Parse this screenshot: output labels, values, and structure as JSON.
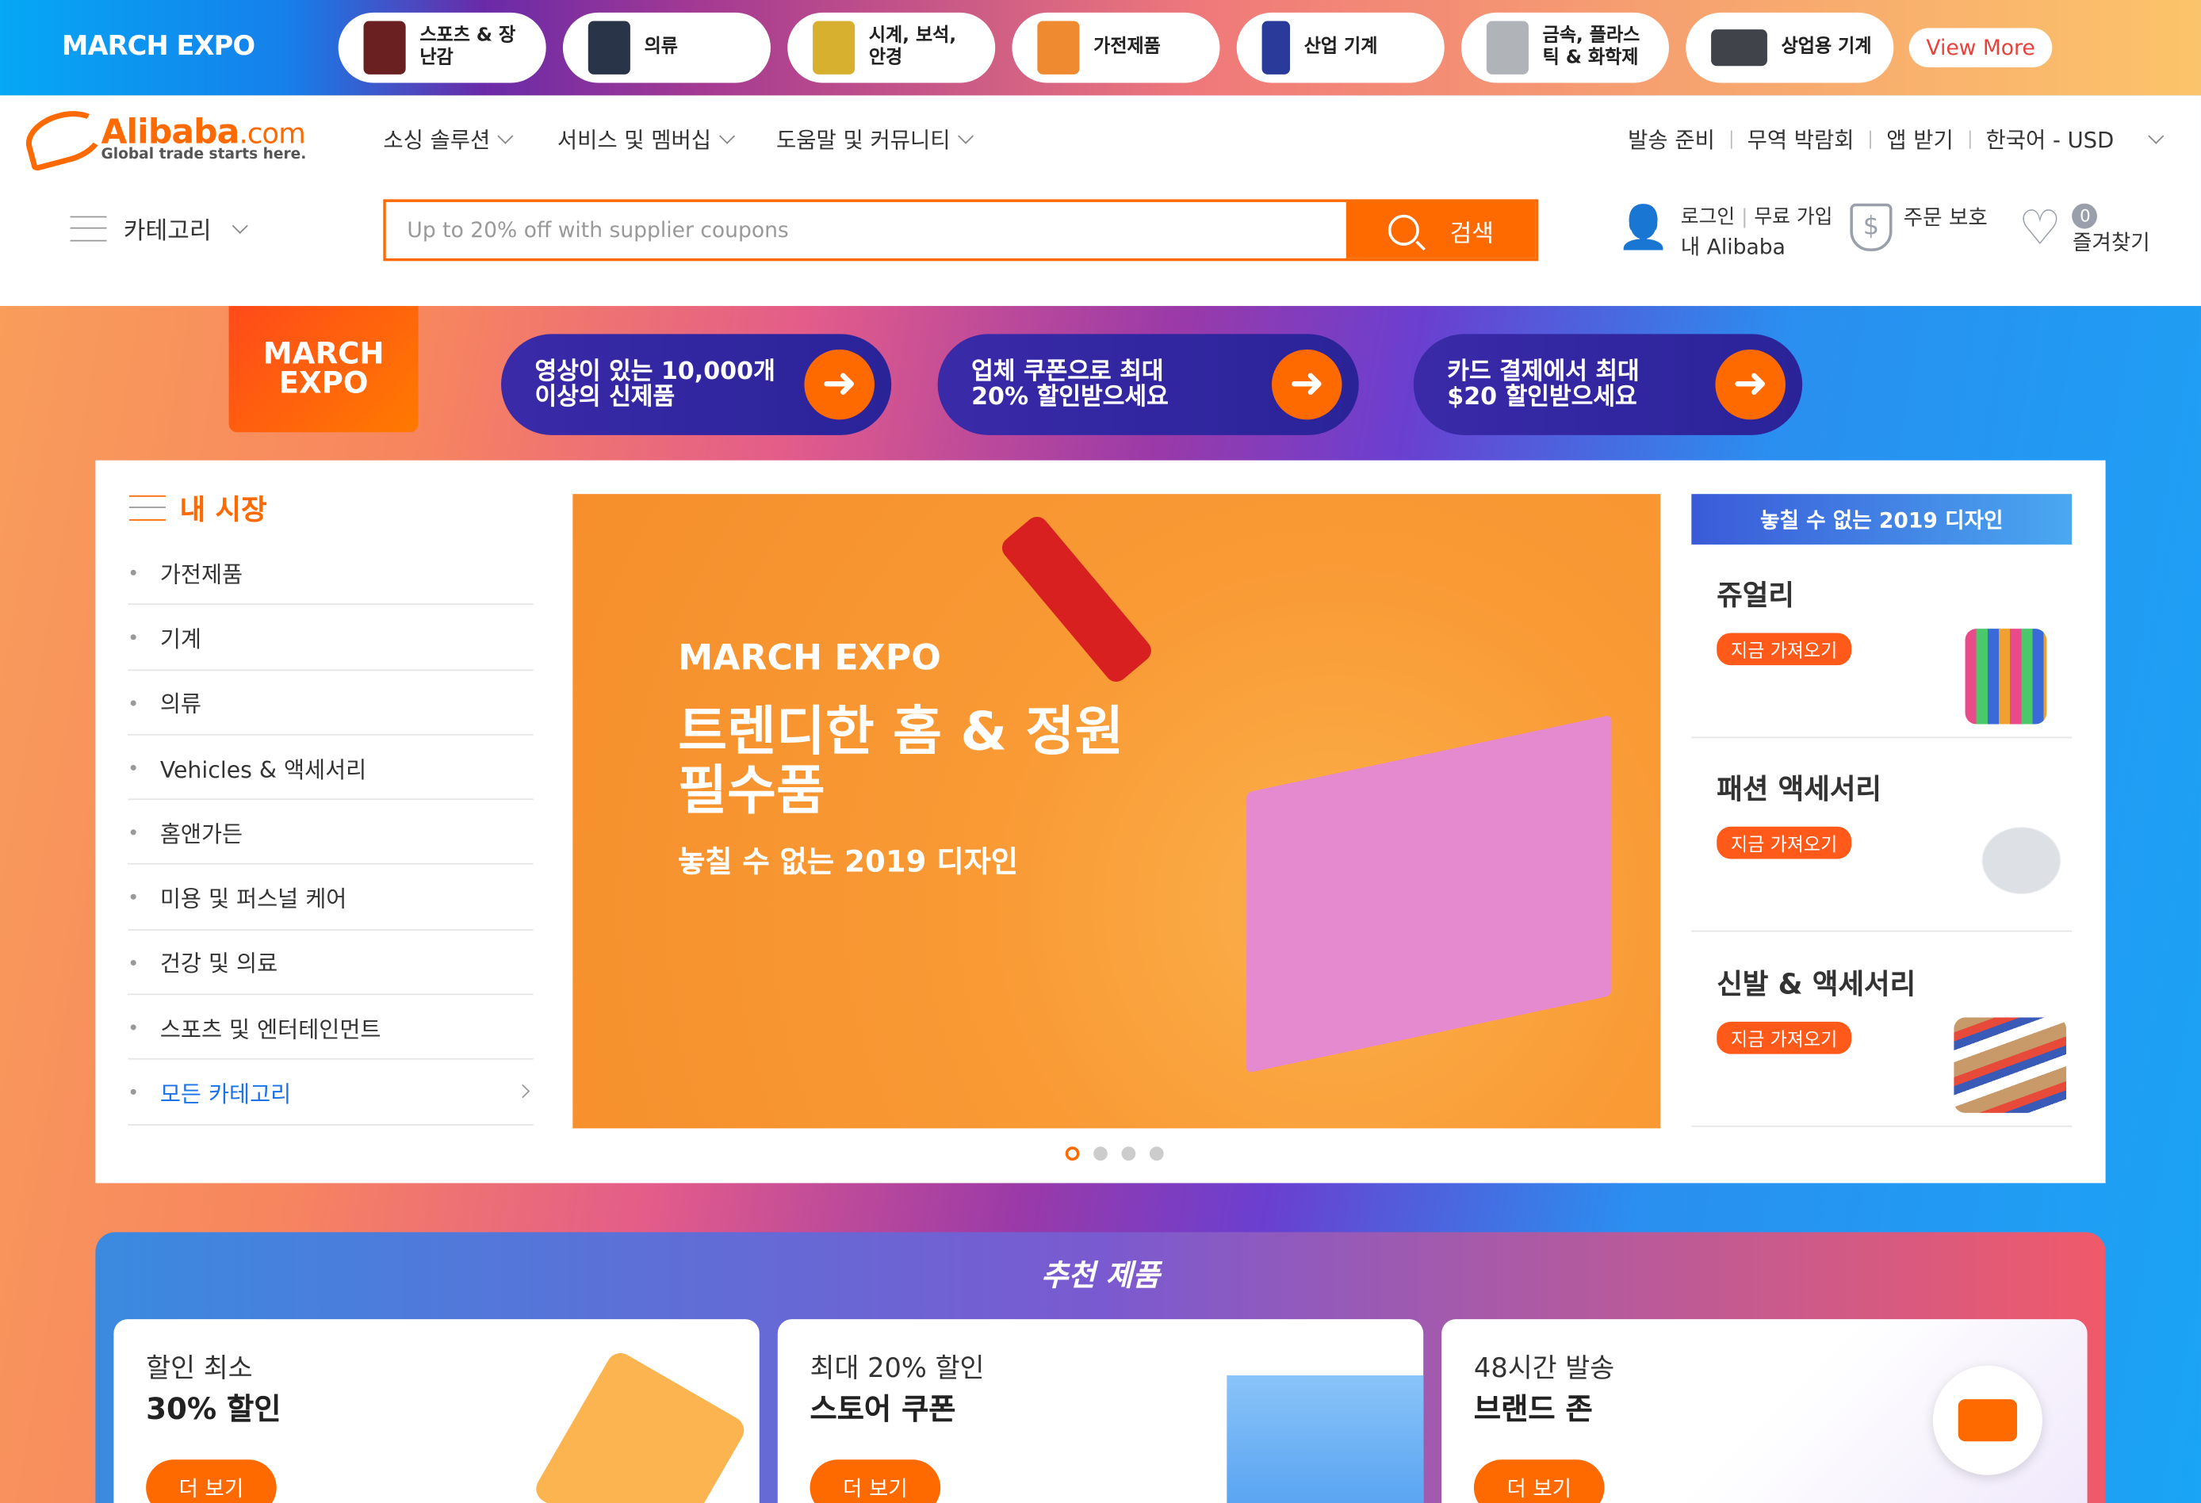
{
  "topbar": {
    "expo_logo": "MARCH EXPO",
    "categories": [
      {
        "label": "스포츠 & 장\n난감",
        "color": "#6a2020"
      },
      {
        "label": "의류",
        "color": "#2a3448"
      },
      {
        "label": "시계, 보석,\n안경",
        "color": "#d8b030"
      },
      {
        "label": "가전제품",
        "color": "#f08a30"
      },
      {
        "label": "산업 기계",
        "color": "#2a3a9a"
      },
      {
        "label": "금속, 플라스\n틱 & 화학제",
        "color": "#b0b4b8"
      },
      {
        "label": "상업용 기계",
        "color": "#40444a"
      }
    ],
    "view_more": "View More"
  },
  "header": {
    "logo": {
      "brand": "Alibaba",
      "domain": ".com",
      "tagline": "Global trade starts here."
    },
    "nav": [
      "소싱 솔루션",
      "서비스 및 멤버십",
      "도움말 및 커뮤니티"
    ],
    "right_nav": [
      "발송 준비",
      "무역 박람회",
      "앱 받기",
      "한국어 - USD"
    ],
    "categories": "카테고리",
    "search": {
      "placeholder": "Up to 20% off with supplier coupons",
      "button": "검색"
    },
    "account": {
      "line1a": "로그인",
      "line1b": "무료 가입",
      "line2": "내 Alibaba"
    },
    "order_protection": "주문 보호",
    "favorites": {
      "label": "즐겨찾기",
      "count": "0"
    }
  },
  "promo": {
    "badge": "MARCH EXPO",
    "pills": [
      "영상이 있는 10,000개\n이상의 신제품",
      "업체 쿠폰으로 최대\n20% 할인받으세요",
      "카드 결제에서 최대\n$20 할인받으세요"
    ]
  },
  "market": {
    "title": "내 시장",
    "items": [
      "가전제품",
      "기계",
      "의류",
      "Vehicles & 액세서리",
      "홈앤가든",
      "미용 및 퍼스널 케어",
      "건강 및 의료",
      "스포츠 및 엔터테인먼트"
    ],
    "all": "모든 카테고리"
  },
  "hero": {
    "brand": "MARCH EXPO",
    "title": "트렌디한 홈 & 정원\n필수품",
    "subtitle": "놓칠 수 없는 2019 디자인",
    "slides": 4,
    "active_slide": 1
  },
  "right": {
    "header": "놓칠 수 없는 2019 디자인",
    "cards": [
      {
        "title": "쥬얼리",
        "button": "지금 가져오기"
      },
      {
        "title": "패션 액세서리",
        "button": "지금 가져오기"
      },
      {
        "title": "신발 & 액세서리",
        "button": "지금 가져오기"
      }
    ]
  },
  "recommended": {
    "title": "추천 제품",
    "cards": [
      {
        "line1": "할인 최소",
        "line2": "30% 할인",
        "button": "더 보기"
      },
      {
        "line1": "최대 20% 할인",
        "line2": "스토어 쿠폰",
        "button": "더 보기"
      },
      {
        "line1": "48시간 발송",
        "line2": "브랜드 존",
        "button": "더 보기"
      }
    ]
  }
}
